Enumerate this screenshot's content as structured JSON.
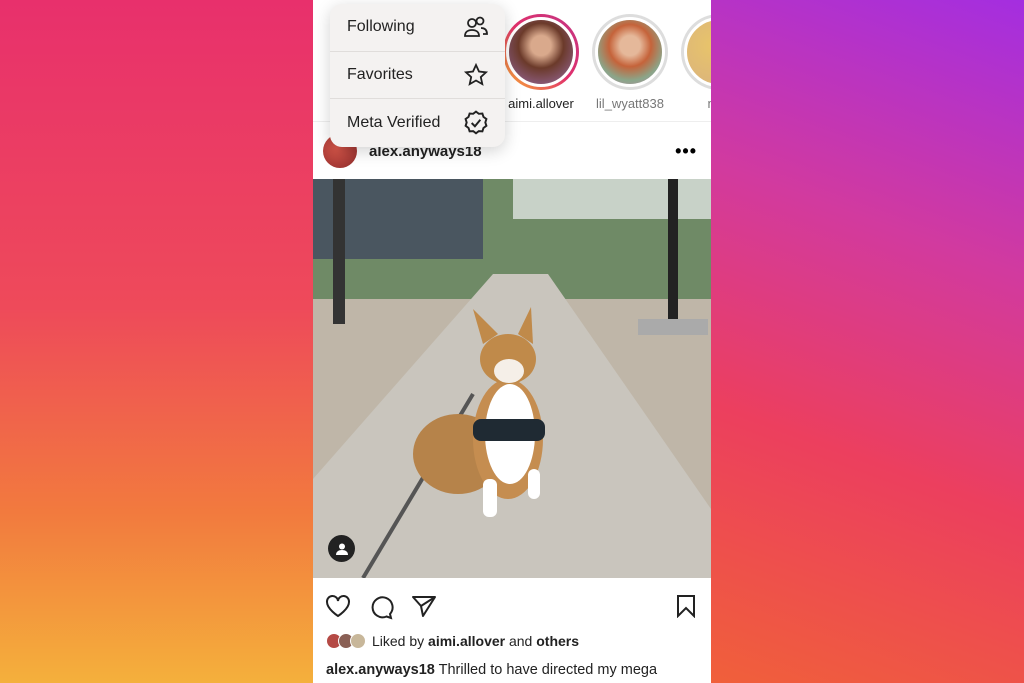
{
  "menu": {
    "items": [
      {
        "label": "Following",
        "icon": "people-icon"
      },
      {
        "label": "Favorites",
        "icon": "star-icon"
      },
      {
        "label": "Meta Verified",
        "icon": "verified-badge-icon"
      }
    ]
  },
  "stories": [
    {
      "name": "aimi.allover"
    },
    {
      "name": "lil_wyatt838"
    },
    {
      "name": "misl"
    }
  ],
  "post": {
    "username": "alex.anyways18",
    "liked_prefix": "Liked by",
    "liked_user": "aimi.allover",
    "liked_and": "and",
    "liked_others": "others",
    "caption": "Thrilled to have directed my mega"
  },
  "colors": {
    "story_ring_start": "#f9b233",
    "story_ring_end": "#c13584"
  }
}
